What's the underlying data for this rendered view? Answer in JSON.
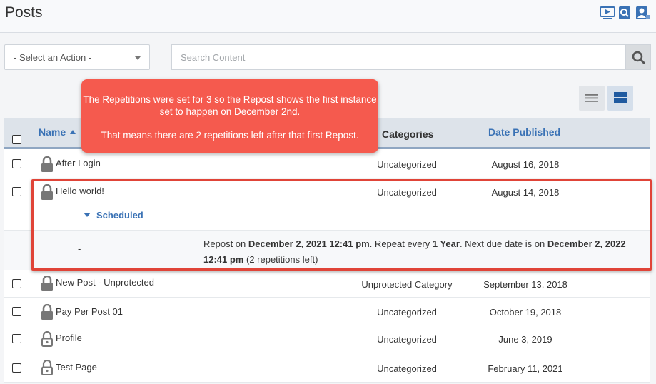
{
  "header": {
    "title": "Posts"
  },
  "toolbar": {
    "action_select": "- Select an Action -",
    "search_placeholder": "Search Content"
  },
  "table": {
    "columns": {
      "name": "Name",
      "categories": "Categories",
      "date": "Date Published"
    },
    "rows": [
      {
        "name": "After Login",
        "category": "Uncategorized",
        "date": "August 16, 2018"
      },
      {
        "name": "Hello world!",
        "category": "Uncategorized",
        "date": "August 14, 2018"
      },
      {
        "name": "New Post - Unprotected",
        "category": "Unprotected Category",
        "date": "September 13, 2018"
      },
      {
        "name": "Pay Per Post 01",
        "category": "Uncategorized",
        "date": "October 19, 2018"
      },
      {
        "name": "Profile",
        "category": "Uncategorized",
        "date": "June 3, 2019"
      },
      {
        "name": "Test Page",
        "category": "Uncategorized",
        "date": "February 11, 2021"
      }
    ]
  },
  "scheduled": {
    "label": "Scheduled",
    "dash": "-",
    "repost_prefix": "Repost on ",
    "repost_date": "December 2, 2021 12:41 pm",
    "repeat_prefix": ". Repeat every ",
    "repeat_interval": "1 Year",
    "next_prefix": ". Next due date is on ",
    "next_date": "December 2, 2022 12:41 pm",
    "remaining": " (2 repetitions left)"
  },
  "callout": {
    "line1": "The Repetitions were set for 3 so the Repost shows the first instance set to happen on December 2nd.",
    "line2": "That means there are 2 repetitions left after that first Repost."
  }
}
